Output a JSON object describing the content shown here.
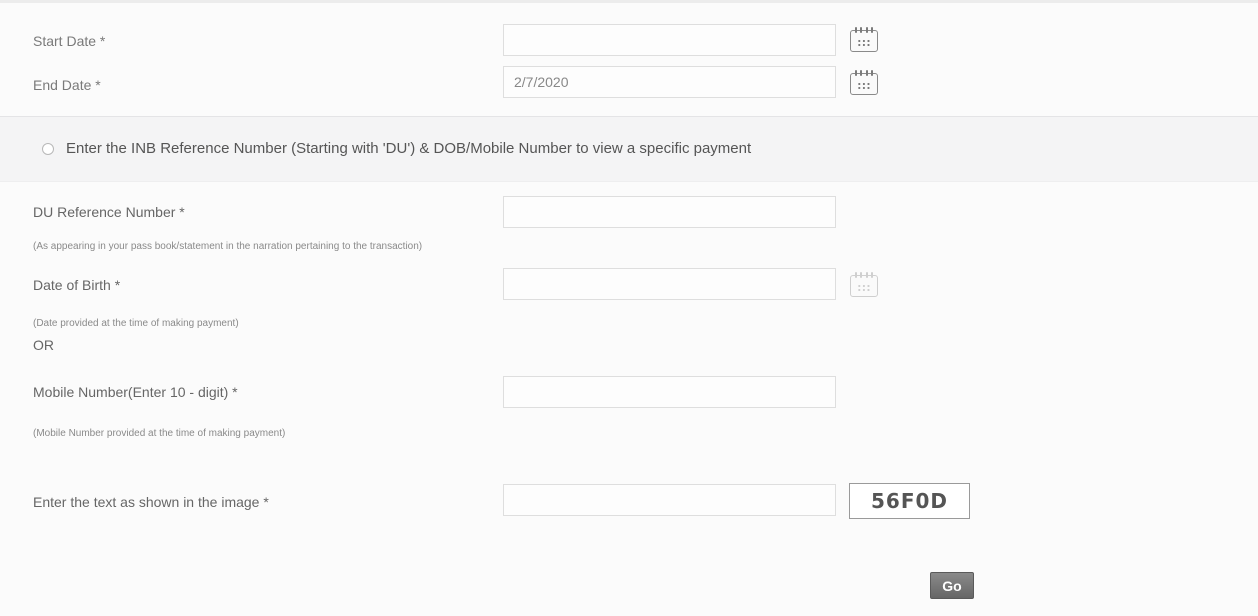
{
  "date_range": {
    "start_label": "Start Date *",
    "start_value": "",
    "end_label": "End Date *",
    "end_value": "2/7/2020"
  },
  "option": {
    "label": "Enter the INB Reference Number (Starting with 'DU') & DOB/Mobile Number to view a specific payment"
  },
  "form": {
    "du_label": "DU Reference Number *",
    "du_value": "",
    "du_hint": "(As appearing in your pass book/statement in the narration pertaining to the transaction)",
    "dob_label": "Date of Birth *",
    "dob_value": "",
    "dob_hint": "(Date provided at the time of making payment)",
    "or_text": "OR",
    "mobile_label": "Mobile Number(Enter 10 - digit) *",
    "mobile_value": "",
    "mobile_hint": "(Mobile Number provided at the time of making payment)",
    "captcha_label": "Enter the text as shown in the image *",
    "captcha_value": "",
    "captcha_text": "56F0D"
  },
  "actions": {
    "go_label": "Go"
  },
  "icons": {
    "start_calendar": "calendar-icon",
    "end_calendar": "calendar-icon",
    "dob_calendar": "calendar-icon"
  }
}
